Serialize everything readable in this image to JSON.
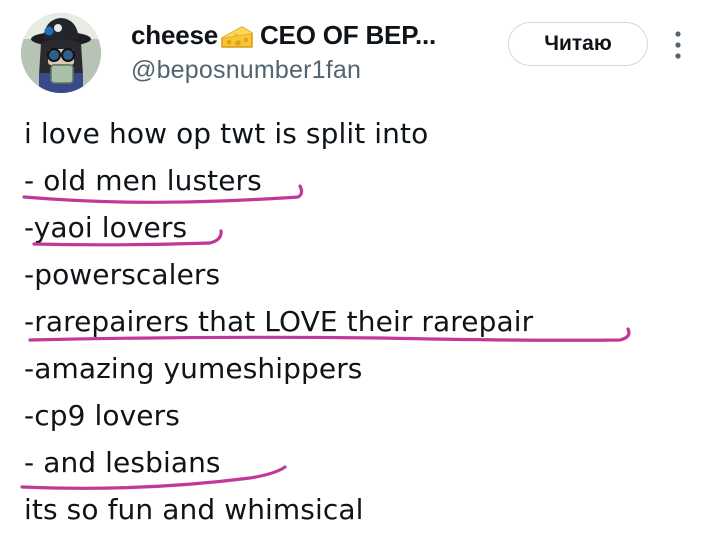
{
  "author": {
    "display_name_start": "cheese",
    "name_icon": "cheese-emoji-icon",
    "display_name_end": "CEO OF BEP...",
    "handle": "@beposnumber1fan",
    "avatar": "avatar-image"
  },
  "actions": {
    "follow_label": "Читаю",
    "more_icon": "more-options-icon"
  },
  "tweet": {
    "lines": [
      "i love how op twt is split into",
      "- old men lusters",
      "-yaoi lovers",
      "-powerscalers",
      "-rarepairers that LOVE their rarepair",
      "-amazing yumeshippers",
      "-cp9 lovers",
      "- and lesbians",
      "its so fun and whimsical"
    ]
  },
  "annotations": {
    "underline_color": "#c0399a",
    "underlined_lines": [
      1,
      2,
      4,
      7
    ]
  }
}
